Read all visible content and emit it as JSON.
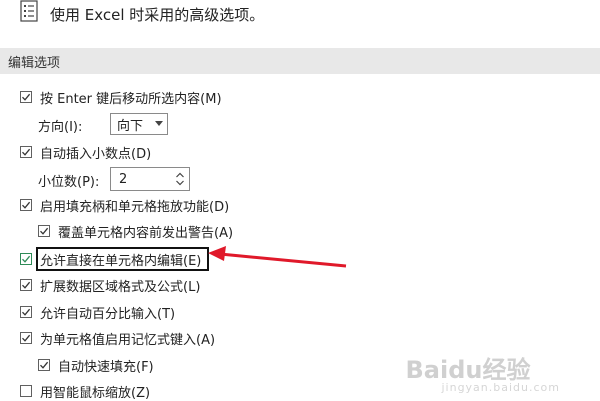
{
  "header": {
    "title": "使用 Excel 时采用的高级选项。",
    "icon": "document-options-icon"
  },
  "section": {
    "label": "编辑选项"
  },
  "options": {
    "move_after_enter": {
      "label": "按 Enter 键后移动所选内容(M)",
      "checked": true
    },
    "direction": {
      "label": "方向(I):",
      "value": "向下"
    },
    "auto_decimal": {
      "label": "自动插入小数点(D)",
      "checked": true
    },
    "places": {
      "label": "小位数(P):",
      "value": "2"
    },
    "fill_handle": {
      "label": "启用填充柄和单元格拖放功能(D)",
      "checked": true
    },
    "alert_overwrite": {
      "label": "覆盖单元格内容前发出警告(A)",
      "checked": true
    },
    "edit_in_cell": {
      "label": "允许直接在单元格内编辑(E)",
      "checked": true
    },
    "extend_formats": {
      "label": "扩展数据区域格式及公式(L)",
      "checked": true
    },
    "auto_percent": {
      "label": "允许自动百分比输入(T)",
      "checked": true
    },
    "autocomplete": {
      "label": "为单元格值启用记忆式键入(A)",
      "checked": true
    },
    "flash_fill": {
      "label": "自动快速填充(F)",
      "checked": true
    },
    "intellimouse_zoom": {
      "label": "用智能鼠标缩放(Z)",
      "checked": false
    }
  },
  "annotation": {
    "color": "#e0192a"
  },
  "watermark": {
    "main": "Baidu经验",
    "sub": "jingyan.baidu.com"
  }
}
